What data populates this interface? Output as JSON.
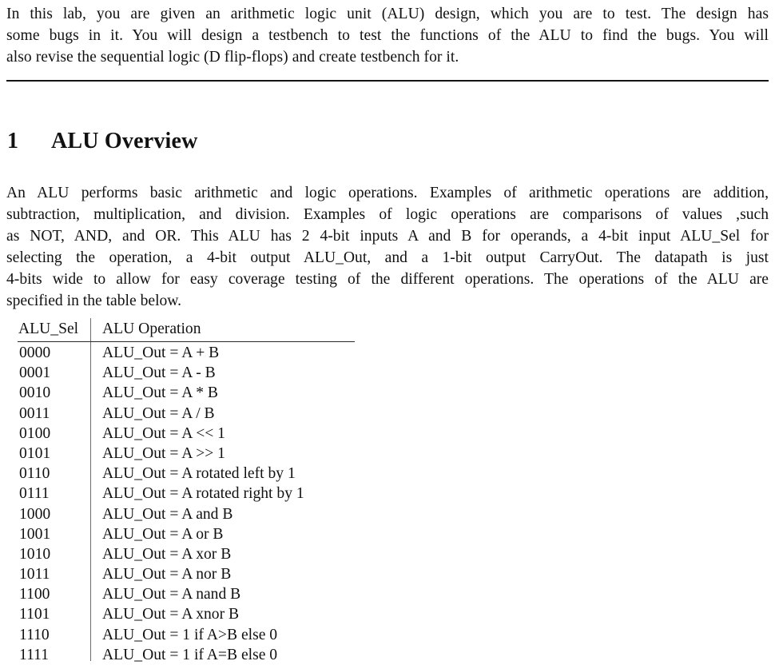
{
  "document": {
    "intro_paragraph": {
      "lines": [
        "In this lab, you are given an arithmetic logic unit (ALU) design, which you are to test. The design has",
        "some bugs in it. You will design a testbench to test the functions of the ALU to find the bugs. You will",
        "also revise the sequential logic (D flip-flops) and create testbench for it."
      ]
    },
    "section": {
      "number": "1",
      "title": "ALU Overview"
    },
    "overview_paragraph": {
      "lines": [
        "An ALU performs basic arithmetic and logic operations. Examples of arithmetic operations are addition,",
        "subtraction, multiplication, and division. Examples of logic operations are comparisons of values ,such",
        "as NOT, AND, and OR. This ALU has 2 4-bit inputs A and B for operands, a 4-bit input ALU_Sel for",
        "selecting the operation, a 4-bit output ALU_Out, and a 1-bit output CarryOut. The datapath is just",
        "4-bits wide to allow for easy coverage testing of the different operations. The operations of the ALU are",
        "specified in the table below."
      ]
    },
    "table": {
      "headers": {
        "sel": "ALU_Sel",
        "operation": "ALU Operation"
      },
      "rows": [
        {
          "sel": "0000",
          "operation": "ALU_Out = A + B"
        },
        {
          "sel": "0001",
          "operation": "ALU_Out = A - B"
        },
        {
          "sel": "0010",
          "operation": "ALU_Out = A * B"
        },
        {
          "sel": "0011",
          "operation": "ALU_Out = A / B"
        },
        {
          "sel": "0100",
          "operation": "ALU_Out = A << 1"
        },
        {
          "sel": "0101",
          "operation": "ALU_Out = A >> 1"
        },
        {
          "sel": "0110",
          "operation": "ALU_Out = A rotated left by 1"
        },
        {
          "sel": "0111",
          "operation": "ALU_Out = A rotated right by 1"
        },
        {
          "sel": "1000",
          "operation": "ALU_Out = A and B"
        },
        {
          "sel": "1001",
          "operation": "ALU_Out = A or B"
        },
        {
          "sel": "1010",
          "operation": "ALU_Out = A xor B"
        },
        {
          "sel": "1011",
          "operation": "ALU_Out = A nor B"
        },
        {
          "sel": "1100",
          "operation": "ALU_Out = A nand B"
        },
        {
          "sel": "1101",
          "operation": "ALU_Out = A xnor B"
        },
        {
          "sel": "1110",
          "operation": "ALU_Out = 1 if A>B else 0"
        },
        {
          "sel": "1111",
          "operation": "ALU_Out = 1 if A=B else 0"
        }
      ]
    },
    "colors": {
      "text": "#111111",
      "rule": "#141414",
      "column_rule": "#6e6e6e",
      "background": "#ffffff"
    }
  }
}
